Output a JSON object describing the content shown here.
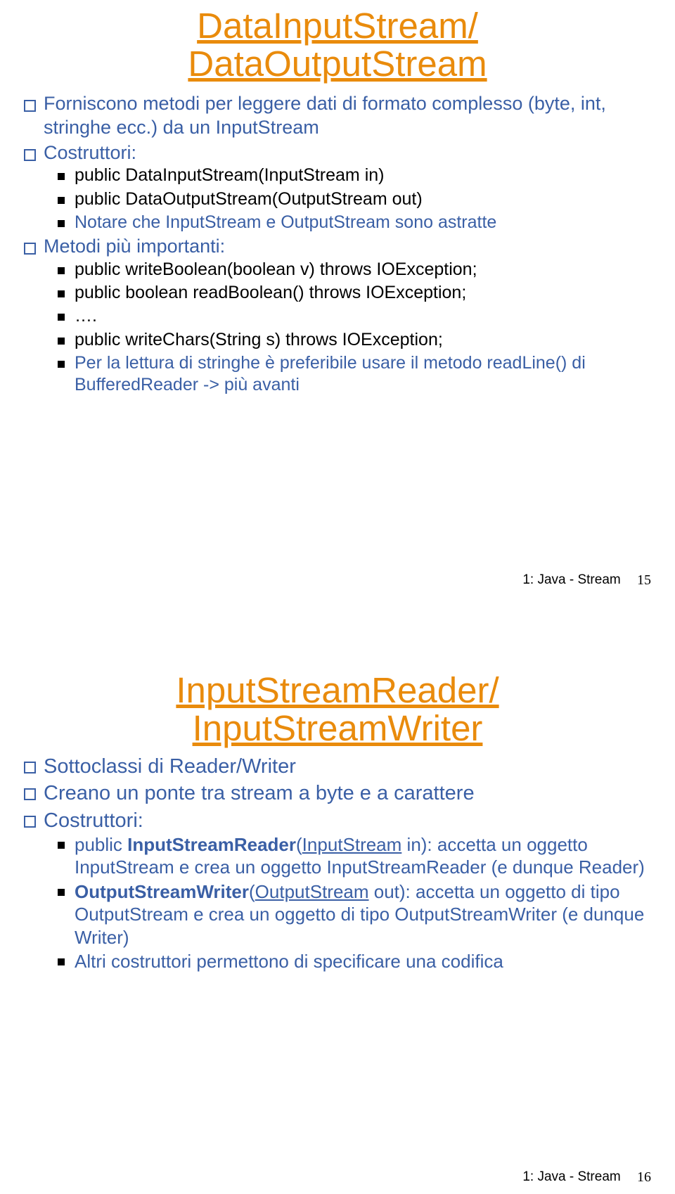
{
  "slide1": {
    "title_line1": "DataInputStream/",
    "title_line2": "DataOutputStream",
    "b1_a": "Forniscono metodi per leggere dati di formato complesso (byte, int, stringhe ecc.) da un InputStream",
    "b2": "Costruttori:",
    "b2_s1": "public DataInputStream(InputStream in)",
    "b2_s2": "public DataOutputStream(OutputStream out)",
    "b2_s3": "Notare che InputStream e OutputStream sono astratte",
    "b3": "Metodi più importanti:",
    "b3_s1": "public writeBoolean(boolean  v) throws IOException;",
    "b3_s2": "public boolean readBoolean() throws IOException;",
    "b3_s3": "….",
    "b3_s4": "public writeChars(String s) throws IOException;",
    "b3_s5": "Per la lettura di stringhe è preferibile usare il metodo readLine() di BufferedReader -> più avanti",
    "footer_label": "1: Java - Stream",
    "page": "15"
  },
  "slide2": {
    "title_line1": "InputStreamReader/",
    "title_line2": "InputStreamWriter",
    "b1": "Sottoclassi di Reader/Writer",
    "b2": "Creano un ponte tra stream a byte e a carattere",
    "b3": "Costruttori:",
    "s1_pre": "public ",
    "s1_bold": "InputStreamReader",
    "s1_paren": "(",
    "s1_link": "InputStream",
    "s1_post": " in): accetta un oggetto InputStream e crea un oggetto InputStreamReader (e dunque Reader)",
    "s2_bold": "OutputStreamWriter",
    "s2_paren": "(",
    "s2_link": "OutputStream",
    "s2_post": " out): accetta un oggetto di tipo OutputStream e crea un oggetto di tipo OutputStreamWriter (e dunque Writer)",
    "s3": "Altri costruttori permettono di specificare una codifica",
    "footer_label": "1: Java - Stream",
    "page": "16"
  }
}
